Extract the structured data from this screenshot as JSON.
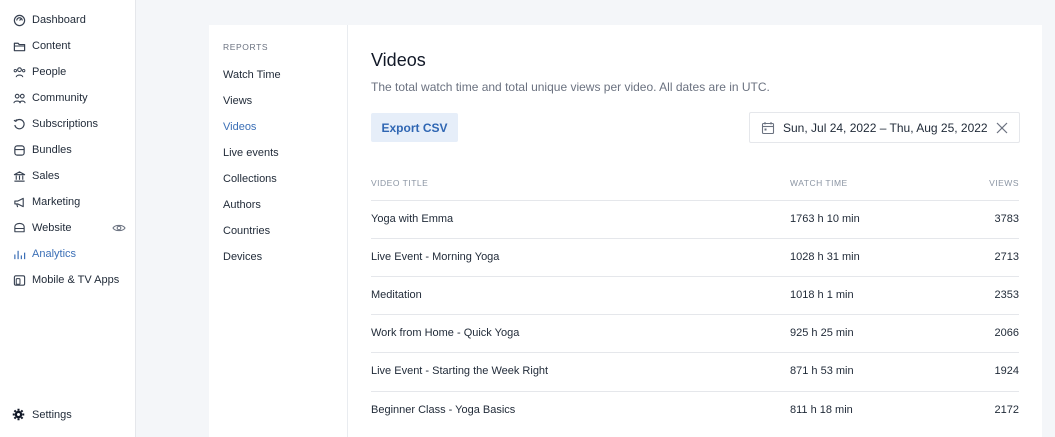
{
  "sidebar": {
    "items": [
      {
        "label": "Dashboard",
        "icon": "dashboard-icon"
      },
      {
        "label": "Content",
        "icon": "folder-icon"
      },
      {
        "label": "People",
        "icon": "people-icon"
      },
      {
        "label": "Community",
        "icon": "community-icon"
      },
      {
        "label": "Subscriptions",
        "icon": "subscriptions-icon"
      },
      {
        "label": "Bundles",
        "icon": "bundles-icon"
      },
      {
        "label": "Sales",
        "icon": "sales-icon"
      },
      {
        "label": "Marketing",
        "icon": "megaphone-icon"
      },
      {
        "label": "Website",
        "icon": "website-icon"
      },
      {
        "label": "Analytics",
        "icon": "analytics-icon",
        "active": true
      },
      {
        "label": "Mobile & TV Apps",
        "icon": "devices-icon"
      }
    ],
    "settings_label": "Settings"
  },
  "reports": {
    "heading": "REPORTS",
    "links": [
      "Watch Time",
      "Views",
      "Videos",
      "Live events",
      "Collections",
      "Authors",
      "Countries",
      "Devices"
    ],
    "active": "Videos"
  },
  "main": {
    "title": "Videos",
    "subtitle": "The total watch time and total unique views per video. All dates are in UTC.",
    "export_label": "Export CSV",
    "date_range": "Sun, Jul 24, 2022 – Thu, Aug 25, 2022",
    "columns": {
      "title": "VIDEO TITLE",
      "watch": "WATCH TIME",
      "views": "VIEWS"
    },
    "rows": [
      {
        "title": "Yoga with Emma",
        "watch": "1763 h 10 min",
        "views": "3783"
      },
      {
        "title": "Live Event - Morning Yoga",
        "watch": "1028 h 31 min",
        "views": "2713"
      },
      {
        "title": "Meditation",
        "watch": "1018 h 1 min",
        "views": "2353"
      },
      {
        "title": "Work from Home - Quick Yoga",
        "watch": "925 h 25 min",
        "views": "2066"
      },
      {
        "title": "Live Event - Starting the Week Right",
        "watch": "871 h 53 min",
        "views": "1924"
      },
      {
        "title": "Beginner Class - Yoga Basics",
        "watch": "811 h 18 min",
        "views": "2172"
      }
    ]
  },
  "colors": {
    "accent": "#3b6fb6",
    "export_bg": "#e6eef9",
    "page_bg": "#f4f6f9"
  }
}
